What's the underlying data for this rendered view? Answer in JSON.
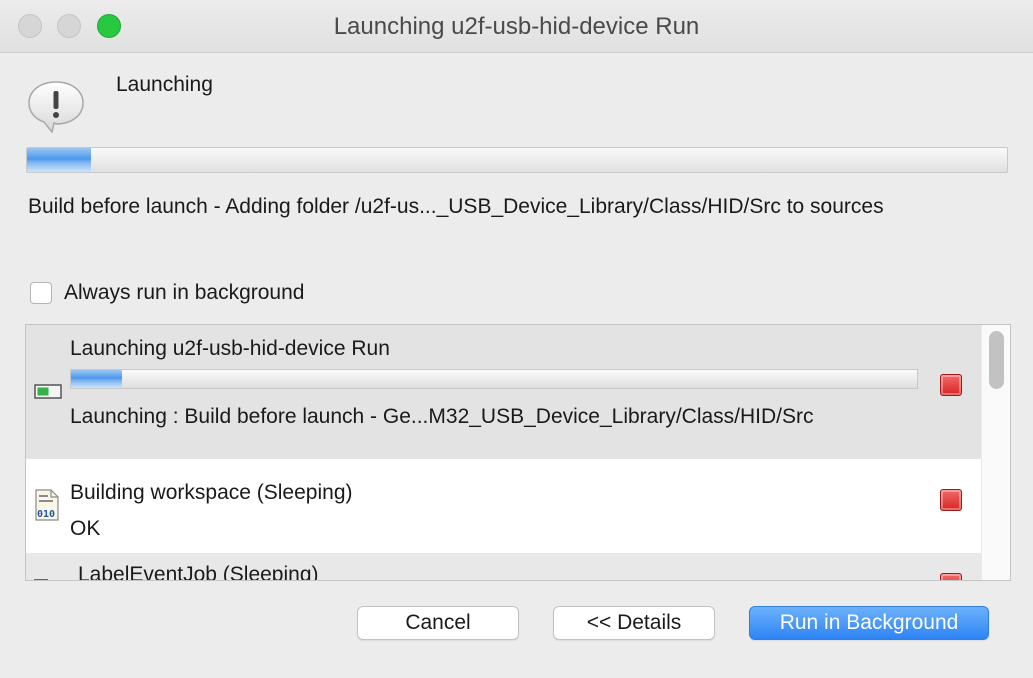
{
  "window": {
    "title": "Launching u2f-usb-hid-device Run"
  },
  "dialog": {
    "heading": "Launching",
    "icon": "warning-bubble-icon",
    "progress_fraction": 0.065,
    "status": "Build before launch -  Adding folder /u2f-us..._USB_Device_Library/Class/HID/Src to sources"
  },
  "options": {
    "always_background_label": "Always run in background",
    "always_background_checked": false
  },
  "jobs": [
    {
      "title": "Launching u2f-usb-hid-device Run",
      "subtitle": "Launching : Build before launch -  Ge...M32_USB_Device_Library/Class/HID/Src",
      "progress_fraction": 0.06,
      "icon": "progress-bar-icon"
    },
    {
      "title": "Building workspace (Sleeping)",
      "subtitle": "OK",
      "icon": "binary-file-icon"
    },
    {
      "title": "LabelEventJob (Sleeping)",
      "icon": "job-icon"
    }
  ],
  "buttons": {
    "cancel": "Cancel",
    "details": "<< Details",
    "run_background": "Run in Background"
  },
  "colors": {
    "accent": "#2d84f5",
    "stop": "#d92323",
    "maximize": "#28c941"
  }
}
